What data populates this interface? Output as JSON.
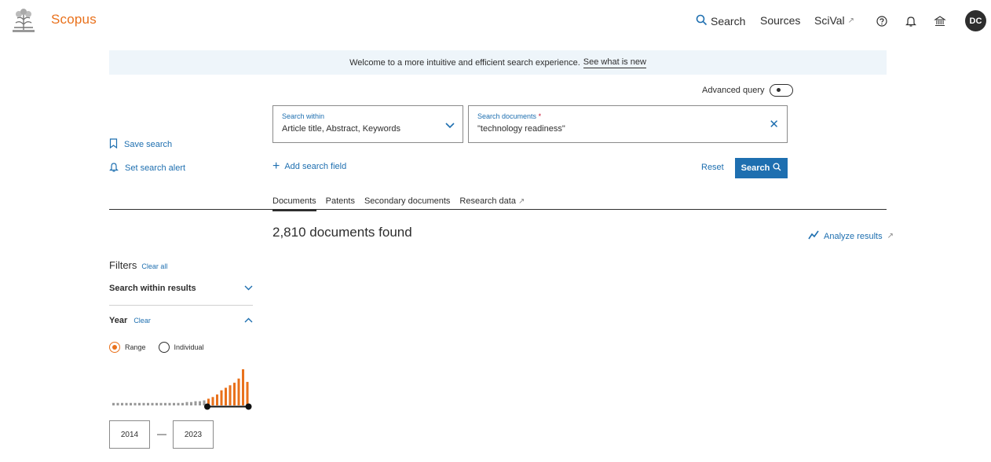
{
  "header": {
    "brand": "Scopus",
    "nav": {
      "search": "Search",
      "sources": "Sources",
      "scival": "SciVal"
    },
    "avatar_initials": "DC",
    "icons": [
      "publisher-logo-icon",
      "search-icon",
      "external-link-icon",
      "help-icon",
      "bell-icon",
      "institution-icon"
    ]
  },
  "banner": {
    "text": "Welcome to a more intuitive and efficient search experience.",
    "link": "See what is new"
  },
  "search": {
    "advanced_label": "Advanced query",
    "within_label": "Search within",
    "within_value": "Article title, Abstract, Keywords",
    "docs_label": "Search documents",
    "docs_required": "*",
    "docs_value": "\"technology readiness\"",
    "add_field": "Add search field",
    "reset": "Reset",
    "search_button": "Search"
  },
  "side_actions": {
    "save_search": "Save search",
    "set_alert": "Set search alert"
  },
  "tabs": [
    "Documents",
    "Patents",
    "Secondary documents",
    "Research data"
  ],
  "results": {
    "count_text": "2,810 documents found",
    "analyze": "Analyze results"
  },
  "filters": {
    "title": "Filters",
    "clear_all": "Clear all",
    "within_results": "Search within results",
    "year_label": "Year",
    "year_clear": "Clear",
    "range_label": "Range",
    "individual_label": "Individual",
    "year_from": "2014",
    "year_to": "2023"
  },
  "histogram": {
    "selected_from_index": 22,
    "selected_to_index": 31,
    "relative_counts": [
      3,
      3,
      3,
      3,
      3,
      3,
      3,
      3,
      3,
      3,
      3,
      3,
      3,
      3,
      3,
      3,
      3,
      4,
      4,
      5,
      5,
      6,
      8,
      10,
      13,
      18,
      21,
      24,
      27,
      32,
      43,
      28
    ],
    "colors": {
      "selected": "#e9711c",
      "unselected": "#9a9a9a"
    }
  },
  "colors": {
    "accent": "#1e6fb0",
    "brand": "#e9711c"
  }
}
